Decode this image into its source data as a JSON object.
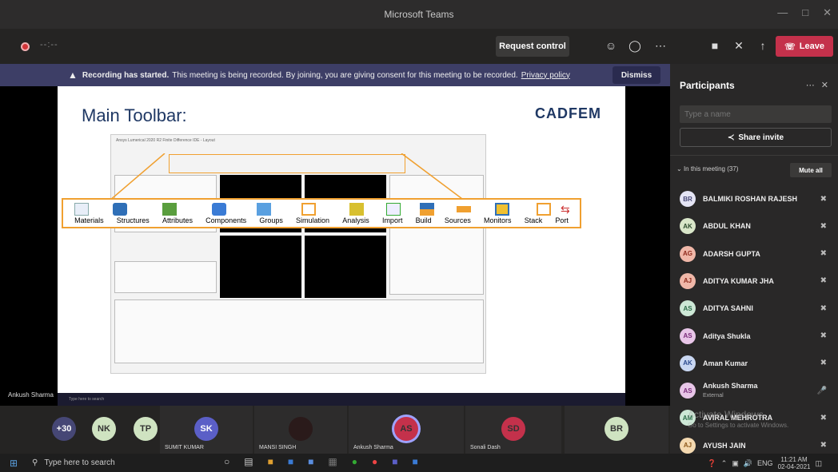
{
  "window": {
    "title": "Microsoft Teams"
  },
  "toolbar": {
    "timer": "--:--",
    "request_control": "Request control",
    "leave": "Leave"
  },
  "banner": {
    "bold": "Recording has started.",
    "text": "This meeting is being recorded. By joining, you are giving consent for this meeting to be recorded.",
    "link": "Privacy policy",
    "dismiss": "Dismiss"
  },
  "slide": {
    "title": "Main Toolbar:",
    "brand": "CADFEM",
    "window_title": "Ansys Lumerical 2020 R2 Finite Difference IDE - Layout",
    "toolbar_items": [
      "Materials",
      "Structures",
      "Attributes",
      "Components",
      "Groups",
      "Simulation",
      "Analysis",
      "Import",
      "Build",
      "Sources",
      "Monitors",
      "Stack",
      "Port"
    ]
  },
  "stage": {
    "speaker_tag": "Ankush Sharma",
    "inner_search": "Type here to search"
  },
  "gallery": {
    "tiles": [
      {
        "initials": "+30",
        "color": "#464775"
      },
      {
        "initials": "NK",
        "color": "#cfe3c1"
      },
      {
        "initials": "TP",
        "color": "#cfe3c1"
      },
      {
        "initials": "SK",
        "color": "#5b5fc7",
        "name": "SUMIT KUMAR"
      },
      {
        "initials": "",
        "color": "#2a1a1a",
        "name": "MANSI SINGH"
      },
      {
        "initials": "AS",
        "color": "#c4314b",
        "name": "Ankush Sharma"
      },
      {
        "initials": "SD",
        "color": "#c4314b",
        "name": "Sonali Dash"
      },
      {
        "initials": "BR",
        "color": "#cfe3c1"
      }
    ]
  },
  "panel": {
    "title": "Participants",
    "search_placeholder": "Type a name",
    "share_invite": "Share invite",
    "in_meeting": "In this meeting (37)",
    "mute_all": "Mute all",
    "people": [
      {
        "initials": "BR",
        "name": "BALMIKI ROSHAN RAJESH",
        "color": "#e4e4f4",
        "fg": "#464775"
      },
      {
        "initials": "AK",
        "name": "ABDUL KHAN",
        "color": "#d9e6c9",
        "fg": "#2d4b2d"
      },
      {
        "initials": "AG",
        "name": "ADARSH GUPTA",
        "color": "#f0b7a8",
        "fg": "#8e2a1c"
      },
      {
        "initials": "AJ",
        "name": "ADITYA KUMAR JHA",
        "color": "#f0b7a8",
        "fg": "#8e2a1c"
      },
      {
        "initials": "AS",
        "name": "ADITYA SAHNI",
        "color": "#cde8d6",
        "fg": "#2b6b48"
      },
      {
        "initials": "AS",
        "name": "Aditya Shukla",
        "color": "#e8c6e8",
        "fg": "#7a2b7a"
      },
      {
        "initials": "AK",
        "name": "Aman Kumar",
        "color": "#c9d7f2",
        "fg": "#2b4a8e"
      },
      {
        "initials": "AS",
        "name": "Ankush Sharma",
        "sub": "External",
        "color": "#e8c6e8",
        "fg": "#7a2b7a"
      },
      {
        "initials": "AM",
        "name": "AVIRAL MEHROTRA",
        "color": "#cde8d6",
        "fg": "#2b6b48"
      },
      {
        "initials": "AJ",
        "name": "AYUSH JAIN",
        "color": "#f4d9b0",
        "fg": "#8e5a1c"
      }
    ]
  },
  "watermark": {
    "line1": "Activate Windows",
    "line2": "Go to Settings to activate Windows."
  },
  "taskbar": {
    "search": "Type here to search",
    "lang": "ENG",
    "time": "11:21 AM",
    "date": "02-04-2021"
  }
}
